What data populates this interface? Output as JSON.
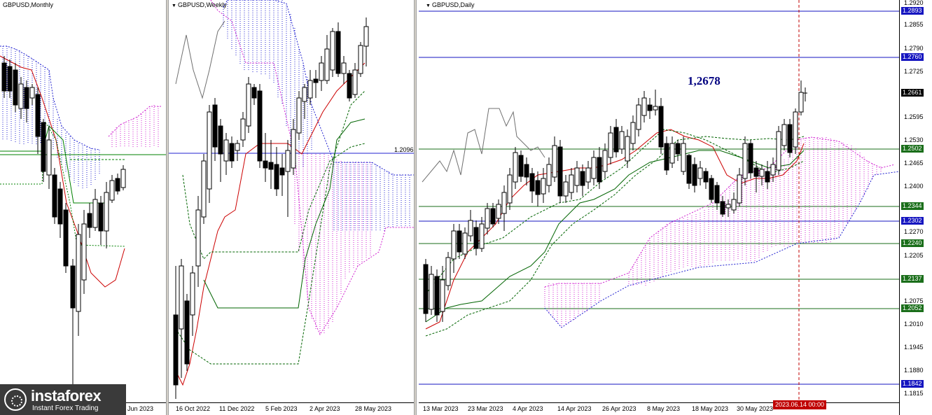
{
  "monthly": {
    "title": "GBPUSD,Monthly",
    "x_labels": [
      "Jun 2023"
    ]
  },
  "weekly": {
    "title": "GBPUSD,Weekly",
    "x_labels": [
      "16 Oct 2022",
      "11 Dec 2022",
      "5 Feb 2023",
      "2 Apr 2023",
      "28 May 2023"
    ],
    "level_label": "1.2096"
  },
  "daily": {
    "title": "GBPUSD,Daily",
    "x_labels": [
      "13 Mar 2023",
      "23 Mar 2023",
      "4 Apr 2023",
      "14 Apr 2023",
      "26 Apr 2023",
      "8 May 2023",
      "18 May 2023",
      "30 May 2023"
    ],
    "annotation": "1,2678",
    "cursor_date": "2023.06.14 00:00",
    "y_labels": [
      "1.2920",
      "1.2855",
      "1.2790",
      "1.2725",
      "1.2595",
      "1.2530",
      "1.2465",
      "1.2400",
      "1.2270",
      "1.2205",
      "1.2075",
      "1.2010",
      "1.1945",
      "1.1880",
      "1.1815"
    ],
    "level_tags": [
      {
        "text": "1.2893",
        "color": "blue"
      },
      {
        "text": "1.2760",
        "color": "blue"
      },
      {
        "text": "1.2661",
        "color": "black"
      },
      {
        "text": "1.2502",
        "color": "green"
      },
      {
        "text": "1.2344",
        "color": "green"
      },
      {
        "text": "1.2302",
        "color": "blue"
      },
      {
        "text": "1.2240",
        "color": "green"
      },
      {
        "text": "1.2137",
        "color": "green"
      },
      {
        "text": "1.2052",
        "color": "green"
      },
      {
        "text": "1.1842",
        "color": "blue"
      }
    ]
  },
  "logo": {
    "name": "instaforex",
    "tagline": "Instant Forex Trading"
  }
}
